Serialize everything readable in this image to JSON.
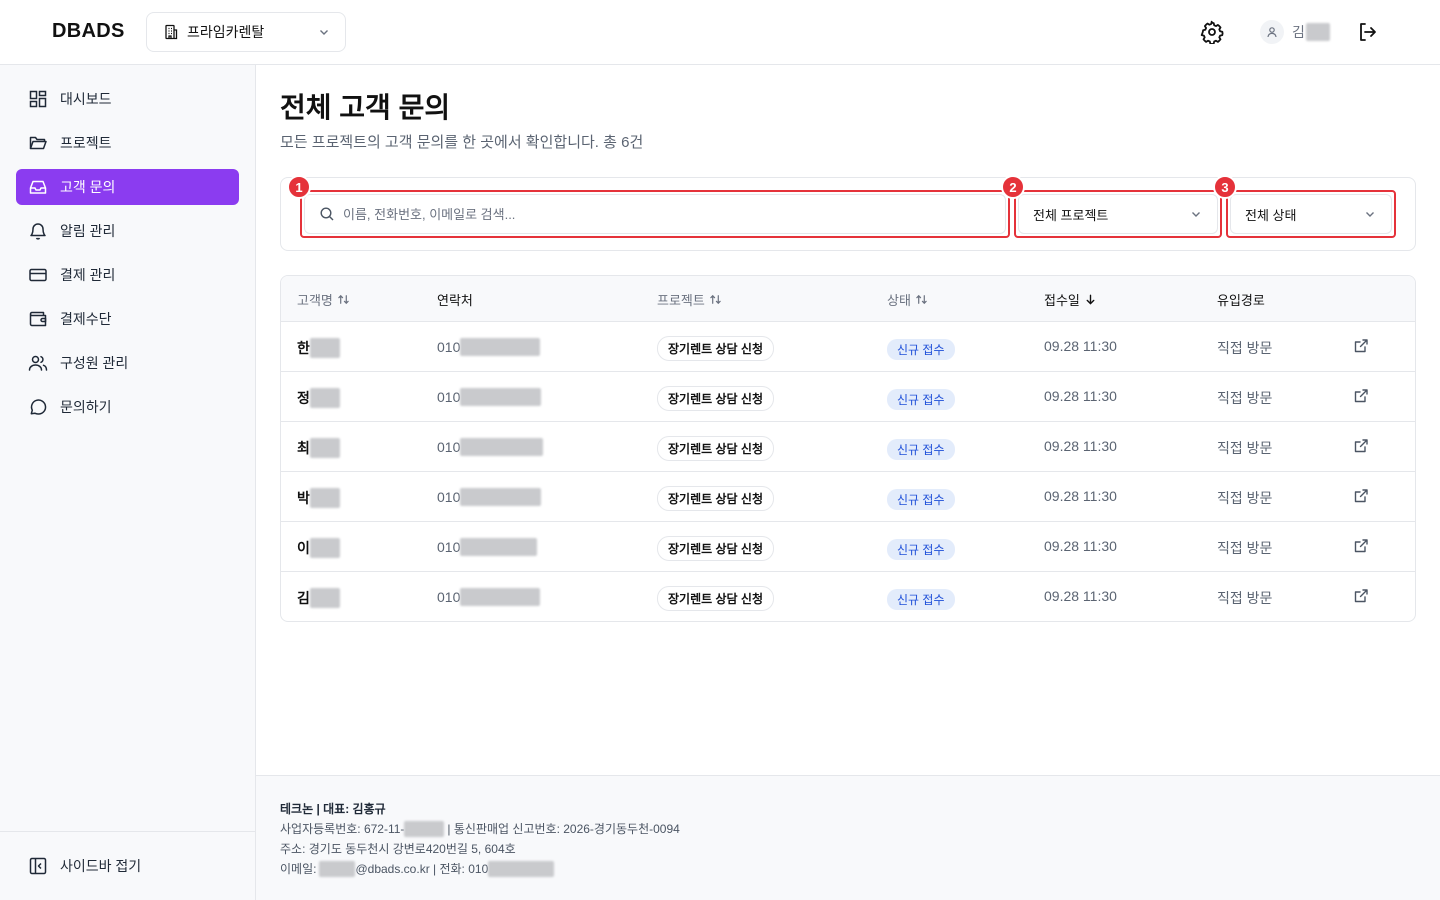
{
  "header": {
    "logo": "DBADS",
    "org_select": "프라임카렌탈",
    "user_initial": "김"
  },
  "sidebar": {
    "items": [
      {
        "label": "대시보드",
        "icon": "dashboard-icon"
      },
      {
        "label": "프로젝트",
        "icon": "folder-icon"
      },
      {
        "label": "고객 문의",
        "icon": "inbox-icon",
        "active": true
      },
      {
        "label": "알림 관리",
        "icon": "bell-icon"
      },
      {
        "label": "결제 관리",
        "icon": "credit-card-icon"
      },
      {
        "label": "결제수단",
        "icon": "wallet-icon"
      },
      {
        "label": "구성원 관리",
        "icon": "users-icon"
      },
      {
        "label": "문의하기",
        "icon": "message-circle-icon"
      }
    ],
    "collapse_label": "사이드바 접기"
  },
  "main": {
    "title": "전체 고객 문의",
    "subtitle": "모든 프로젝트의 고객 문의를 한 곳에서 확인합니다. 총 6건"
  },
  "filters": {
    "search_placeholder": "이름, 전화번호, 이메일로 검색...",
    "project_select": "전체 프로젝트",
    "status_select": "전체 상태",
    "markers": [
      "1",
      "2",
      "3"
    ]
  },
  "table": {
    "headers": {
      "name": "고객명",
      "phone": "연락처",
      "project": "프로젝트",
      "status": "상태",
      "date": "접수일",
      "source": "유입경로"
    },
    "rows": [
      {
        "name": "한",
        "phone": "010",
        "project": "장기렌트 상담 신청",
        "status": "신규 접수",
        "date": "09.28 11:30",
        "source": "직접 방문"
      },
      {
        "name": "정",
        "phone": "010",
        "project": "장기렌트 상담 신청",
        "status": "신규 접수",
        "date": "09.28 11:30",
        "source": "직접 방문"
      },
      {
        "name": "최",
        "phone": "010",
        "project": "장기렌트 상담 신청",
        "status": "신규 접수",
        "date": "09.28 11:30",
        "source": "직접 방문"
      },
      {
        "name": "박",
        "phone": "010",
        "project": "장기렌트 상담 신청",
        "status": "신규 접수",
        "date": "09.28 11:30",
        "source": "직접 방문"
      },
      {
        "name": "이",
        "phone": "010",
        "project": "장기렌트 상담 신청",
        "status": "신규 접수",
        "date": "09.28 11:30",
        "source": "직접 방문"
      },
      {
        "name": "김",
        "phone": "010",
        "project": "장기렌트 상담 신청",
        "status": "신규 접수",
        "date": "09.28 11:30",
        "source": "직접 방문"
      }
    ]
  },
  "footer": {
    "company": "테크논 | 대표: 김홍규",
    "biz_no_prefix": "사업자등록번호: 672-11-",
    "biz_no_suffix": "| 통신판매업 신고번호: 2026-경기동두천-0094",
    "address": "주소: 경기도 동두천시 강변로420번길 5, 604호",
    "email_prefix": "이메일:",
    "email_suffix": "@dbads.co.kr | 전화: 010"
  },
  "colors": {
    "accent": "#8b3cf0",
    "highlight": "#e5323a",
    "status_text": "#1d4ed8",
    "status_bg": "#e3ecfb"
  }
}
